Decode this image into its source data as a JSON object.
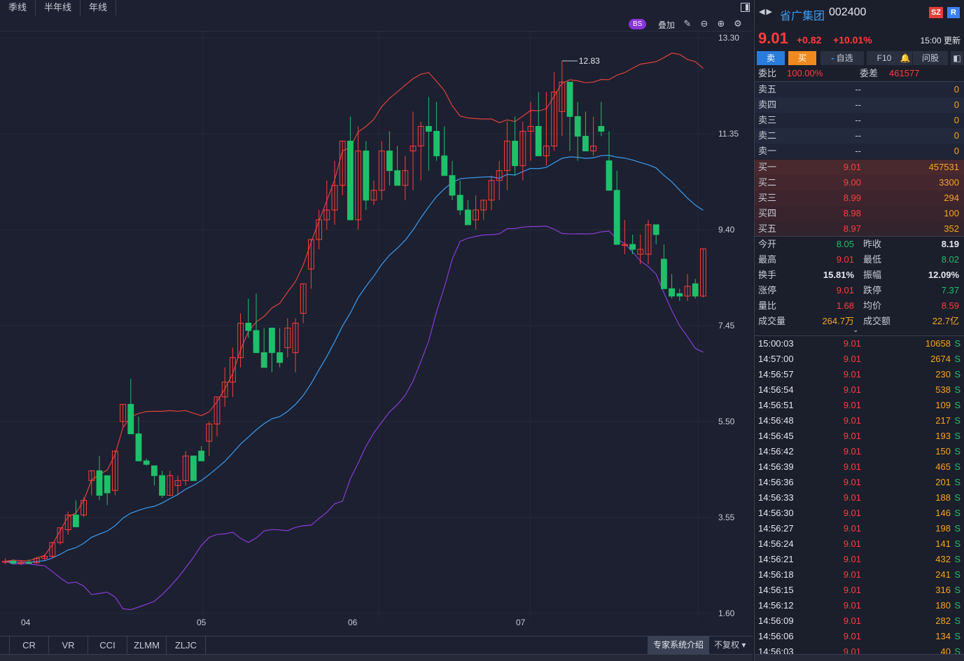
{
  "period_tabs": [
    "季线",
    "半年线",
    "年线"
  ],
  "toolbar": {
    "bs_label": "BS",
    "overlay_label": "叠加",
    "icons": [
      "pencil-icon",
      "minus-icon",
      "plus-icon",
      "gear-icon"
    ]
  },
  "chart_data": {
    "type": "candlestick",
    "y_ticks": [
      "13.30",
      "11.35",
      "9.40",
      "7.45",
      "5.50",
      "3.55",
      "1.60"
    ],
    "ylim": [
      1.6,
      13.3
    ],
    "x_ticks": [
      "04",
      "05",
      "06",
      "07"
    ],
    "max_annotation": "12.83",
    "candles": [
      [
        2.65,
        2.72,
        2.6,
        2.66
      ],
      [
        2.66,
        2.7,
        2.6,
        2.62
      ],
      [
        2.62,
        2.68,
        2.58,
        2.64
      ],
      [
        2.64,
        2.7,
        2.6,
        2.63
      ],
      [
        2.63,
        2.75,
        2.6,
        2.72
      ],
      [
        2.72,
        2.8,
        2.68,
        2.76
      ],
      [
        2.76,
        3.04,
        2.74,
        3.04
      ],
      [
        3.04,
        3.34,
        3.0,
        3.34
      ],
      [
        3.3,
        3.67,
        3.2,
        3.6
      ],
      [
        3.6,
        3.9,
        3.45,
        3.36
      ],
      [
        3.6,
        3.96,
        3.56,
        3.9
      ],
      [
        4.3,
        4.4,
        4.0,
        4.5
      ],
      [
        4.5,
        4.8,
        3.9,
        4.0
      ],
      [
        4.4,
        4.1,
        3.8,
        4.05
      ],
      [
        4.1,
        4.9,
        4.0,
        4.9
      ],
      [
        5.5,
        5.85,
        5.4,
        5.85
      ],
      [
        5.85,
        6.37,
        5.6,
        5.25
      ],
      [
        5.25,
        5.6,
        4.7,
        4.7
      ],
      [
        4.7,
        4.75,
        4.6,
        4.63
      ],
      [
        4.6,
        4.6,
        4.2,
        4.4
      ],
      [
        4.4,
        4.5,
        3.95,
        4.0
      ],
      [
        4.0,
        4.5,
        4.0,
        4.4
      ],
      [
        4.2,
        4.4,
        4.0,
        4.3
      ],
      [
        4.3,
        4.9,
        4.2,
        4.8
      ],
      [
        4.8,
        4.8,
        4.3,
        4.3
      ],
      [
        4.9,
        5.0,
        4.7,
        4.7
      ],
      [
        5.1,
        5.5,
        4.8,
        5.45
      ],
      [
        5.45,
        6.0,
        5.2,
        6.0
      ],
      [
        6.0,
        6.6,
        5.8,
        6.3
      ],
      [
        6.3,
        7.0,
        6.0,
        6.8
      ],
      [
        6.8,
        7.7,
        6.6,
        7.5
      ],
      [
        7.5,
        8.0,
        7.2,
        7.35
      ],
      [
        7.35,
        8.1,
        7.0,
        6.9
      ],
      [
        6.9,
        7.4,
        6.6,
        6.6
      ],
      [
        7.4,
        7.2,
        6.5,
        6.9
      ],
      [
        6.9,
        7.4,
        6.6,
        6.7
      ],
      [
        7.0,
        7.6,
        6.8,
        7.4
      ],
      [
        6.9,
        7.6,
        6.5,
        7.5
      ],
      [
        7.7,
        8.0,
        7.5,
        8.3
      ],
      [
        8.6,
        8.3,
        8.2,
        9.2
      ],
      [
        9.2,
        9.8,
        9.0,
        9.6
      ],
      [
        9.6,
        10.4,
        9.4,
        9.8
      ],
      [
        9.8,
        10.8,
        9.5,
        10.3
      ],
      [
        10.3,
        11.0,
        10.1,
        11.2
      ],
      [
        11.2,
        11.7,
        10.8,
        9.6
      ],
      [
        9.6,
        11.5,
        9.4,
        11.0
      ],
      [
        11.0,
        11.2,
        9.8,
        10.0
      ],
      [
        10.0,
        10.4,
        9.9,
        10.2
      ],
      [
        10.2,
        11.2,
        10.0,
        11.0
      ],
      [
        11.0,
        11.4,
        10.3,
        10.6
      ],
      [
        10.6,
        11.1,
        10.5,
        10.3
      ],
      [
        10.3,
        10.9,
        10.0,
        10.6
      ],
      [
        11.0,
        11.8,
        10.2,
        11.1
      ],
      [
        11.1,
        11.6,
        10.4,
        11.5
      ],
      [
        11.5,
        12.1,
        10.6,
        11.4
      ],
      [
        11.4,
        12.0,
        10.8,
        10.9
      ],
      [
        10.9,
        11.5,
        10.5,
        10.5
      ],
      [
        10.5,
        10.8,
        10.0,
        10.1
      ],
      [
        10.1,
        10.4,
        9.7,
        9.8
      ],
      [
        9.8,
        10.0,
        9.5,
        9.5
      ],
      [
        9.6,
        10.1,
        9.4,
        9.8
      ],
      [
        9.8,
        10.0,
        9.6,
        10.0
      ],
      [
        10.0,
        10.5,
        9.8,
        10.4
      ],
      [
        10.4,
        10.8,
        10.0,
        10.6
      ],
      [
        10.6,
        11.6,
        10.2,
        11.2
      ],
      [
        11.2,
        11.7,
        10.5,
        10.7
      ],
      [
        10.7,
        11.6,
        10.4,
        11.4
      ],
      [
        11.4,
        12.0,
        10.8,
        11.5
      ],
      [
        11.5,
        12.2,
        10.9,
        10.9
      ],
      [
        10.9,
        12.2,
        10.7,
        11.1
      ],
      [
        11.1,
        12.6,
        11.0,
        12.2
      ],
      [
        11.8,
        12.83,
        11.3,
        12.4
      ],
      [
        12.4,
        12.4,
        11.0,
        11.7
      ],
      [
        11.7,
        12.0,
        10.8,
        11.3
      ],
      [
        11.3,
        11.8,
        11.0,
        11.0
      ],
      [
        11.0,
        11.7,
        10.9,
        11.1
      ],
      [
        11.5,
        12.0,
        11.3,
        11.4
      ],
      [
        10.8,
        11.4,
        10.3,
        10.2
      ],
      [
        10.2,
        10.6,
        9.8,
        9.1
      ],
      [
        9.1,
        9.6,
        8.9,
        9.1
      ],
      [
        9.1,
        9.3,
        8.9,
        9.0
      ],
      [
        8.9,
        9.3,
        8.7,
        9.0
      ],
      [
        8.9,
        9.6,
        8.7,
        9.5
      ],
      [
        9.5,
        9.5,
        9.1,
        9.3
      ],
      [
        8.8,
        9.1,
        8.4,
        8.2
      ],
      [
        8.2,
        8.5,
        8.0,
        8.05
      ],
      [
        8.1,
        8.2,
        7.95,
        8.05
      ],
      [
        8.05,
        8.5,
        7.95,
        8.25
      ],
      [
        8.3,
        8.4,
        8.0,
        8.05
      ],
      [
        8.05,
        9.01,
        8.02,
        9.01
      ]
    ],
    "legend": "none",
    "grid": true
  },
  "indicator_tabs": [
    "CR",
    "VR",
    "CCI",
    "ZLMM",
    "ZLJC"
  ],
  "expert_label": "专家系统介绍",
  "fq_label": "不复权",
  "stock": {
    "name": "省广集团",
    "code": "002400",
    "market_badge": "SZ",
    "r_badge": "R",
    "price": "9.01",
    "change": "+0.82",
    "change_pct": "+10.01%",
    "update_time": "15:00 更新"
  },
  "actions": {
    "sell": "卖",
    "buy": "买",
    "fav": "自选",
    "f10": "F10",
    "ask": "问股"
  },
  "ratio": {
    "wb_label": "委比",
    "wb_value": "100.00%",
    "wc_label": "委差",
    "wc_value": "461577"
  },
  "sell_orders": [
    {
      "label": "卖五",
      "price": "--",
      "vol": "0"
    },
    {
      "label": "卖四",
      "price": "--",
      "vol": "0"
    },
    {
      "label": "卖三",
      "price": "--",
      "vol": "0"
    },
    {
      "label": "卖二",
      "price": "--",
      "vol": "0"
    },
    {
      "label": "卖一",
      "price": "--",
      "vol": "0"
    }
  ],
  "buy_orders": [
    {
      "label": "买一",
      "price": "9.01",
      "vol": "457531"
    },
    {
      "label": "买二",
      "price": "9.00",
      "vol": "3300"
    },
    {
      "label": "买三",
      "price": "8.99",
      "vol": "294"
    },
    {
      "label": "买四",
      "price": "8.98",
      "vol": "100"
    },
    {
      "label": "买五",
      "price": "8.97",
      "vol": "352"
    }
  ],
  "quote": [
    {
      "l1": "今开",
      "v1": "8.05",
      "c1": "green",
      "l2": "昨收",
      "v2": "8.19",
      "c2": "white"
    },
    {
      "l1": "最高",
      "v1": "9.01",
      "c1": "red",
      "l2": "最低",
      "v2": "8.02",
      "c2": "green"
    },
    {
      "l1": "换手",
      "v1": "15.81%",
      "c1": "white",
      "l2": "振幅",
      "v2": "12.09%",
      "c2": "white"
    },
    {
      "l1": "涨停",
      "v1": "9.01",
      "c1": "red",
      "l2": "跌停",
      "v2": "7.37",
      "c2": "green"
    },
    {
      "l1": "量比",
      "v1": "1.68",
      "c1": "red",
      "l2": "均价",
      "v2": "8.59",
      "c2": "red"
    },
    {
      "l1": "成交量",
      "v1": "264.7万",
      "c1": "orange",
      "l2": "成交额",
      "v2": "22.7亿",
      "c2": "orange"
    }
  ],
  "ticks": [
    {
      "time": "15:00:03",
      "price": "9.01",
      "vol": "10658",
      "dir": "S"
    },
    {
      "time": "14:57:00",
      "price": "9.01",
      "vol": "2674",
      "dir": "S"
    },
    {
      "time": "14:56:57",
      "price": "9.01",
      "vol": "230",
      "dir": "S"
    },
    {
      "time": "14:56:54",
      "price": "9.01",
      "vol": "538",
      "dir": "S"
    },
    {
      "time": "14:56:51",
      "price": "9.01",
      "vol": "109",
      "dir": "S"
    },
    {
      "time": "14:56:48",
      "price": "9.01",
      "vol": "217",
      "dir": "S"
    },
    {
      "time": "14:56:45",
      "price": "9.01",
      "vol": "193",
      "dir": "S"
    },
    {
      "time": "14:56:42",
      "price": "9.01",
      "vol": "150",
      "dir": "S"
    },
    {
      "time": "14:56:39",
      "price": "9.01",
      "vol": "465",
      "dir": "S"
    },
    {
      "time": "14:56:36",
      "price": "9.01",
      "vol": "201",
      "dir": "S"
    },
    {
      "time": "14:56:33",
      "price": "9.01",
      "vol": "188",
      "dir": "S"
    },
    {
      "time": "14:56:30",
      "price": "9.01",
      "vol": "146",
      "dir": "S"
    },
    {
      "time": "14:56:27",
      "price": "9.01",
      "vol": "198",
      "dir": "S"
    },
    {
      "time": "14:56:24",
      "price": "9.01",
      "vol": "141",
      "dir": "S"
    },
    {
      "time": "14:56:21",
      "price": "9.01",
      "vol": "432",
      "dir": "S"
    },
    {
      "time": "14:56:18",
      "price": "9.01",
      "vol": "241",
      "dir": "S"
    },
    {
      "time": "14:56:15",
      "price": "9.01",
      "vol": "316",
      "dir": "S"
    },
    {
      "time": "14:56:12",
      "price": "9.01",
      "vol": "180",
      "dir": "S"
    },
    {
      "time": "14:56:09",
      "price": "9.01",
      "vol": "282",
      "dir": "S"
    },
    {
      "time": "14:56:06",
      "price": "9.01",
      "vol": "134",
      "dir": "S"
    },
    {
      "time": "14:56:03",
      "price": "9.01",
      "vol": "40",
      "dir": "S"
    }
  ],
  "colors": {
    "up": "#ff3d3d",
    "down": "#1fc06b",
    "bg": "#1c2030",
    "boll_upper": "#e0423c",
    "boll_mid": "#3c9df4",
    "boll_lower": "#8a3cd8"
  }
}
